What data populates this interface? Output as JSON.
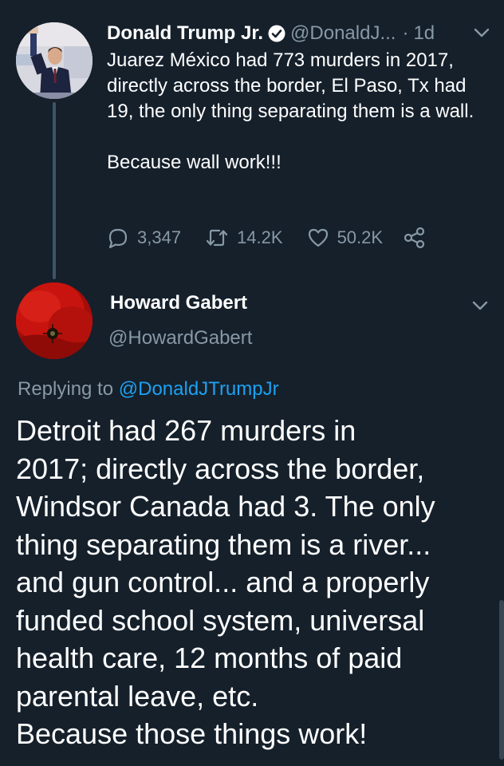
{
  "tweet": {
    "author_name": "Donald Trump Jr.",
    "handle": "@DonaldJ...",
    "separator": "·",
    "time": "1d",
    "text_1": "Juarez México had 773 murders in 2017, directly across the border, El Paso, Tx had 19, the only thing separating them is a wall.",
    "text_2": "Because wall work!!!",
    "reply_count": "3,347",
    "retweet_count": "14.2K",
    "like_count": "50.2K",
    "icons": [
      "verified-badge-icon",
      "chevron-down-icon",
      "reply-icon",
      "retweet-icon",
      "like-icon",
      "share-icon"
    ]
  },
  "reply": {
    "author_name": "Howard Gabert",
    "handle": "@HowardGabert",
    "replying_prefix": "Replying to ",
    "replying_mention": "@DonaldJTrumpJr",
    "text": "Detroit had 267 murders in\n2017; directly across the border,\nWindsor Canada had 3.  The only\nthing separating them is a river...\nand gun control... and a properly\nfunded school system, universal\nhealth care, 12 months of paid\nparental leave, etc.\nBecause those things work!"
  },
  "colors": {
    "background": "#15202b",
    "secondary_text": "#8899a6",
    "link": "#1da1f2",
    "thread_line": "#3d5466"
  }
}
